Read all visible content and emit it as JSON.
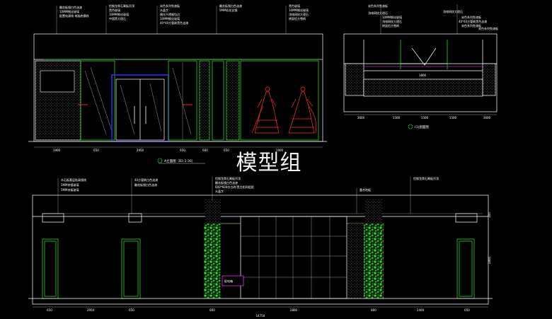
{
  "watermark": "模型组",
  "view_a": {
    "title": "A立面图（B2-1:30）",
    "callouts_left": [
      "雕花板镜白色油漆",
      "10MM钢化玻璃",
      "配置电源线-电脑底横线"
    ],
    "callouts_mid": [
      "铝钢龙骨石膏板吊顶",
      "黑色玻璃",
      "10MM钢化玻璃",
      "中国黑大理石"
    ],
    "callouts_mid2": [
      "米色系列免漆板",
      "水晶字",
      "偶光不透钢包边",
      "10MM钢化玻璃",
      "40*40方管刷黑色油漆"
    ],
    "callouts_right": [
      "雕花板镜白色油漆",
      "5MM彩花丝镜"
    ],
    "callouts_right2": [
      "黑色玻璃",
      "10MM钢化玻璃",
      "浅啡网纹大理石",
      "烤面铝方雪柄"
    ],
    "dims": [
      "1900",
      "650",
      "2950",
      "650",
      "600",
      "650",
      "1900"
    ]
  },
  "view_section": {
    "title": "(1)剖面图",
    "callouts_left": [
      "米色系列免漆板",
      "浅啡网纹大理石",
      "10MM钢化玻璃",
      "浅啡网纹大理石",
      "烤面铝方雪柄"
    ],
    "callouts_right": [
      "浅啡网纹大理石",
      "米色系列免漆板",
      "40*40方管刷黑色油漆",
      "米色系列免漆板",
      "米色系列免漆板"
    ],
    "dims_top": [
      "1800"
    ],
    "dims_bottom": [
      "3600",
      "1500",
      "1500",
      "1500",
      "3600"
    ]
  },
  "view_b": {
    "callouts_left": [
      "木石板基层贴高镜线",
      "5MM茶镜玻璃",
      "5MM夹板玻璃"
    ],
    "callouts_mid": [
      "40方管刷白色油漆",
      "雕花板镜白色油漆"
    ],
    "callouts_mid2": [
      "铝钢龙骨石膏板吊顶",
      "雕花板镜白色油漆",
      "600*600仿古砖/黑白相间组图",
      "水晶字"
    ],
    "callouts_right": [
      "重合地板"
    ],
    "callouts_far_right": [
      "铝钢龙骨石膏板吊顶"
    ],
    "label_box": "配电箱",
    "dims": [
      "650",
      "2950",
      "650",
      "800",
      "2800",
      "800",
      "2400",
      "650"
    ],
    "total_dim": "14750",
    "height_dims": [
      "300",
      "2800"
    ]
  },
  "colors": {
    "background": "#000000",
    "line": "#ffffff",
    "glass": "#27d027",
    "door": "#2d2dff",
    "figure": "#ff3030",
    "title": "#ff00ff"
  }
}
